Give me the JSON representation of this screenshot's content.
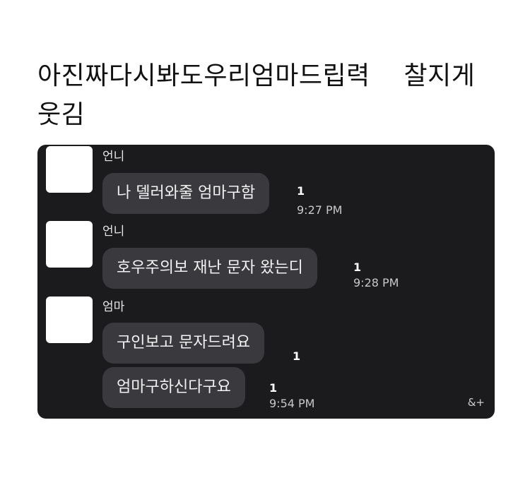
{
  "caption": "아진짜다시봐도우리엄마드립력    찰지게\n웃김",
  "messages": [
    {
      "sender": "언니",
      "text": "나 델러와줄 엄마구함",
      "unread": "1",
      "time": "9:27 PM"
    },
    {
      "sender": "언니",
      "text": "호우주의보 재난 문자 왔는디",
      "unread": "1",
      "time": "9:28 PM"
    },
    {
      "sender": "엄마",
      "text": "구인보고 문자드려요",
      "unread": "1",
      "time": ""
    },
    {
      "sender": "",
      "text": "엄마구하신다구요",
      "unread": "1",
      "time": "9:54 PM"
    }
  ],
  "more_label": "&+"
}
